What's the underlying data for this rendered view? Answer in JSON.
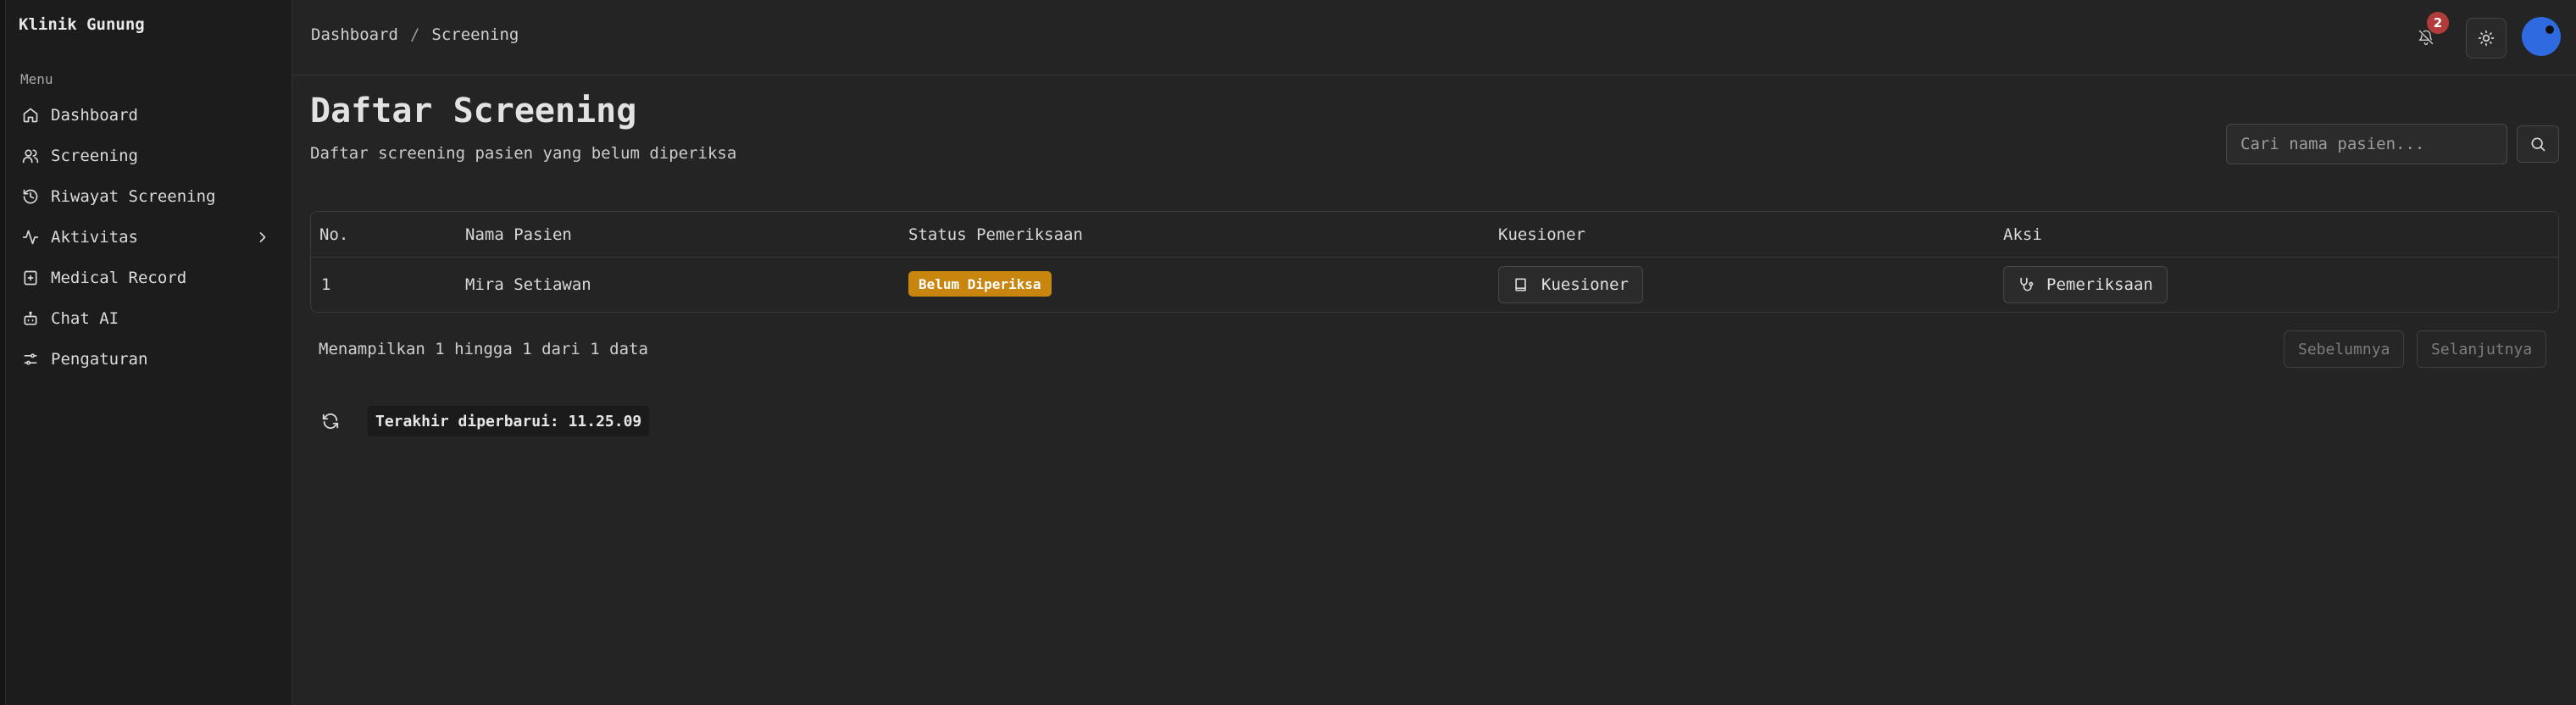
{
  "app": {
    "brand": "Klinik Gunung"
  },
  "sidebar": {
    "menu_label": "Menu",
    "items": [
      {
        "label": "Dashboard",
        "icon": "home-icon"
      },
      {
        "label": "Screening",
        "icon": "users-icon"
      },
      {
        "label": "Riwayat Screening",
        "icon": "history-icon"
      },
      {
        "label": "Aktivitas",
        "icon": "activity-icon",
        "has_submenu": true
      },
      {
        "label": "Medical Record",
        "icon": "medical-file-icon"
      },
      {
        "label": "Chat AI",
        "icon": "bot-icon"
      },
      {
        "label": "Pengaturan",
        "icon": "settings-icon"
      }
    ]
  },
  "header": {
    "breadcrumb": [
      "Dashboard",
      "Screening"
    ],
    "breadcrumb_sep": "/",
    "notification_count": "2",
    "avatar_color": "#2f6ae0"
  },
  "main": {
    "title": "Daftar Screening",
    "subtitle": "Daftar screening pasien yang belum diperiksa",
    "search": {
      "placeholder": "Cari nama pasien...",
      "value": ""
    },
    "table": {
      "columns": [
        "No.",
        "Nama Pasien",
        "Status Pemeriksaan",
        "Kuesioner",
        "Aksi"
      ],
      "rows": [
        {
          "no": "1",
          "name": "Mira Setiawan",
          "status": "Belum Diperiksa",
          "status_color": "#c9860f",
          "kuesioner_label": "Kuesioner",
          "aksi_label": "Pemeriksaan"
        }
      ]
    },
    "pagination": {
      "summary": "Menampilkan 1 hingga 1 dari 1 data",
      "prev_label": "Sebelumnya",
      "next_label": "Selanjutnya"
    },
    "last_updated": "Terakhir diperbarui: 11.25.09"
  }
}
